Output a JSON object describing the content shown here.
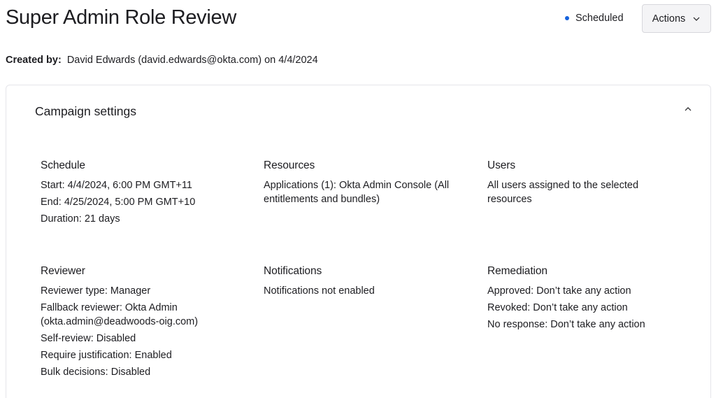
{
  "header": {
    "title": "Super Admin Role Review",
    "status": {
      "label": "Scheduled",
      "color": "#1662dd"
    },
    "actions_label": "Actions"
  },
  "created": {
    "label": "Created by:",
    "value": "David Edwards (david.edwards@okta.com) on 4/4/2024"
  },
  "campaign": {
    "title": "Campaign settings",
    "sections": {
      "schedule": {
        "heading": "Schedule",
        "lines": [
          "Start: 4/4/2024, 6:00 PM GMT+11",
          "End: 4/25/2024, 5:00 PM GMT+10",
          "Duration: 21 days"
        ]
      },
      "resources": {
        "heading": "Resources",
        "lines": [
          "Applications (1): Okta Admin Console (All entitlements and bundles)"
        ]
      },
      "users": {
        "heading": "Users",
        "lines": [
          "All users assigned to the selected resources"
        ]
      },
      "reviewer": {
        "heading": "Reviewer",
        "lines": [
          "Reviewer type: Manager",
          "Fallback reviewer: Okta Admin (okta.admin@deadwoods-oig.com)",
          "Self-review: Disabled",
          "Require justification: Enabled",
          "Bulk decisions: Disabled"
        ]
      },
      "notifications": {
        "heading": "Notifications",
        "lines": [
          "Notifications not enabled"
        ]
      },
      "remediation": {
        "heading": "Remediation",
        "lines": [
          "Approved: Don’t take any action",
          "Revoked: Don’t take any action",
          "No response: Don’t take any action"
        ]
      }
    }
  }
}
